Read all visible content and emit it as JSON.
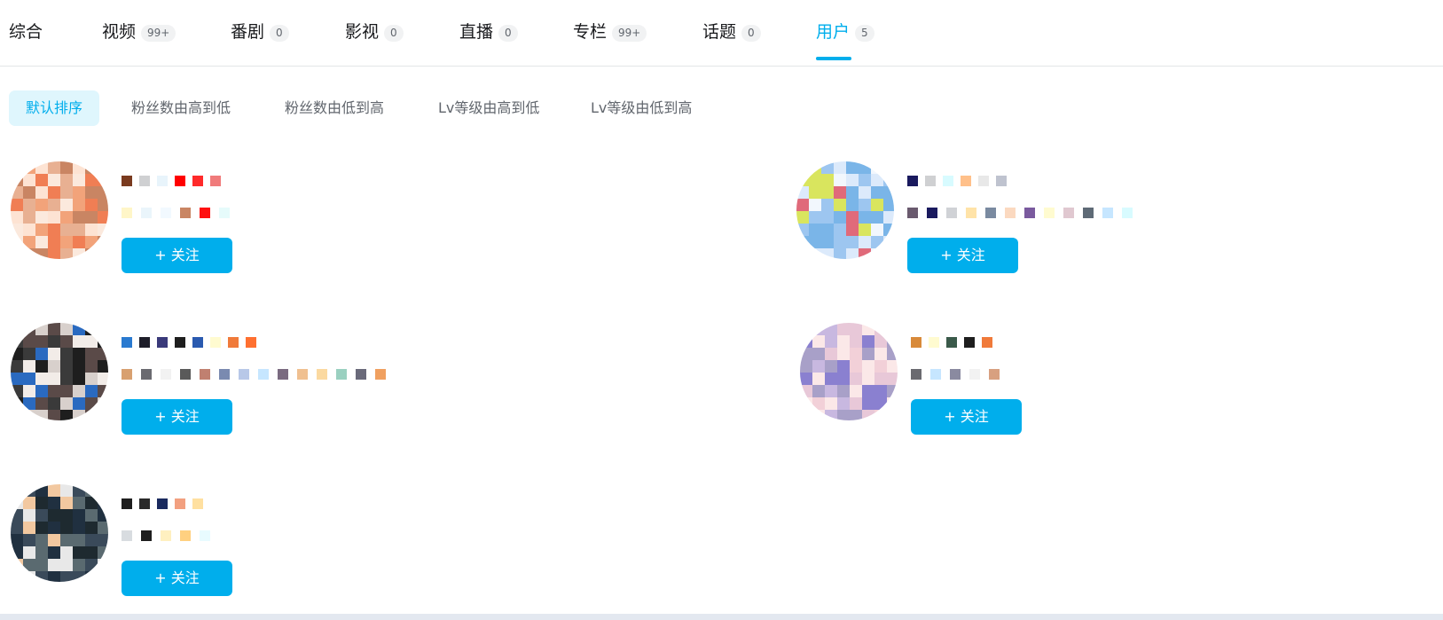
{
  "tabs": [
    {
      "label": "综合",
      "count": ""
    },
    {
      "label": "视频",
      "count": "99+"
    },
    {
      "label": "番剧",
      "count": "0"
    },
    {
      "label": "影视",
      "count": "0"
    },
    {
      "label": "直播",
      "count": "0"
    },
    {
      "label": "专栏",
      "count": "99+"
    },
    {
      "label": "话题",
      "count": "0"
    },
    {
      "label": "用户",
      "count": "5"
    }
  ],
  "active_tab": "用户",
  "sort_options": [
    "默认排序",
    "粉丝数由高到低",
    "粉丝数由低到高",
    "Lv等级由高到低",
    "Lv等级由低到高"
  ],
  "active_sort": "默认排序",
  "users": [
    {
      "follow_label": "+ 关注"
    },
    {
      "follow_label": "+ 关注"
    },
    {
      "follow_label": "+ 关注"
    },
    {
      "follow_label": "+ 关注"
    },
    {
      "follow_label": "+ 关注"
    }
  ],
  "colors": {
    "accent": "#00aeec",
    "sort_active_bg": "#dff6fd",
    "count_bg": "#f1f2f3",
    "text": "#18191c",
    "muted": "#61666d"
  }
}
